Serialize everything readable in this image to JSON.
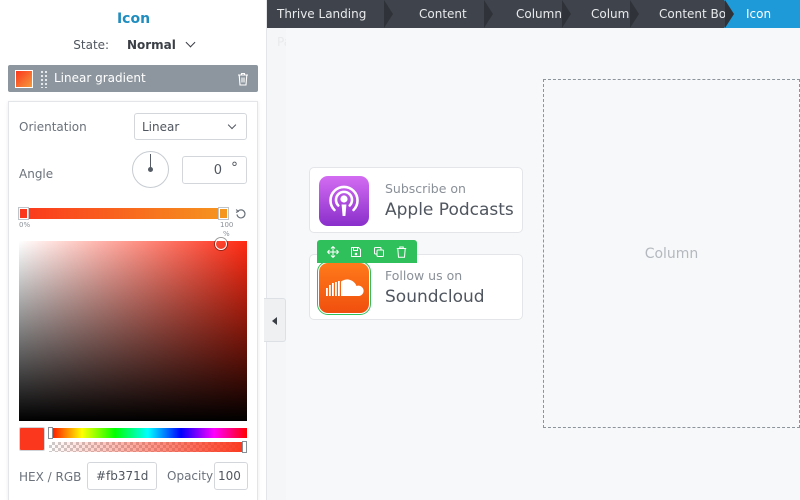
{
  "sidebar": {
    "title": "Icon",
    "state_label": "State:",
    "state_value": "Normal",
    "layer": {
      "label": "Linear gradient"
    },
    "gradient": {
      "orientation_label": "Orientation",
      "orientation_value": "Linear",
      "angle_label": "Angle",
      "angle_value": "0",
      "angle_unit": "°",
      "stop_start_label": "0%",
      "stop_end_label": "100",
      "stop_end_unit": "%",
      "stop_start_color": "#fb371d",
      "stop_end_color": "#f5961f"
    },
    "picker": {
      "hex_label": "HEX / RGB",
      "hex_value": "#fb371d",
      "opacity_label": "Opacity",
      "opacity_value": "100"
    }
  },
  "breadcrumb": [
    "Thrive Landing Page",
    "Content Box",
    "Columns",
    "Column",
    "Content Box",
    "Icon"
  ],
  "canvas": {
    "podcast": {
      "pre": "Subscribe on",
      "main": "Apple Podcasts"
    },
    "soundcloud": {
      "pre": "Follow us on",
      "main": "Soundcloud"
    },
    "column_label": "Column"
  },
  "colors": {
    "accent": "#1f9ad8",
    "selection": "#2fbf5b",
    "breadcrumb_bg": "#3f444c"
  }
}
